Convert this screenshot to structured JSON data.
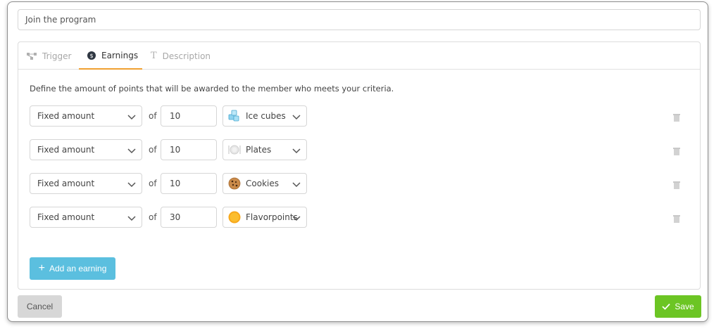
{
  "program": {
    "name_value": "Join the program"
  },
  "tabs": [
    {
      "label": "Trigger",
      "icon": "trigger-icon",
      "active": false
    },
    {
      "label": "Earnings",
      "icon": "dollar-coin-icon",
      "active": true
    },
    {
      "label": "Description",
      "icon": "text-icon",
      "active": false
    }
  ],
  "earnings": {
    "intro": "Define the amount of points that will be awarded to the member who meets your criteria.",
    "of_label": "of",
    "rows": [
      {
        "type": "Fixed amount",
        "amount": "10",
        "currency": "Ice cubes",
        "currency_icon": "ice-cubes-icon"
      },
      {
        "type": "Fixed amount",
        "amount": "10",
        "currency": "Plates",
        "currency_icon": "plates-icon"
      },
      {
        "type": "Fixed amount",
        "amount": "10",
        "currency": "Cookies",
        "currency_icon": "cookie-icon"
      },
      {
        "type": "Fixed amount",
        "amount": "30",
        "currency": "Flavorpoints",
        "currency_icon": "flavorpoints-icon"
      }
    ],
    "add_label": "Add an earning"
  },
  "footer": {
    "cancel_label": "Cancel",
    "save_label": "Save"
  },
  "colors": {
    "accent_tab": "#f0a030",
    "add_button": "#5bbfdf",
    "save_button": "#6cc524",
    "cancel_button": "#d7d7d7"
  }
}
